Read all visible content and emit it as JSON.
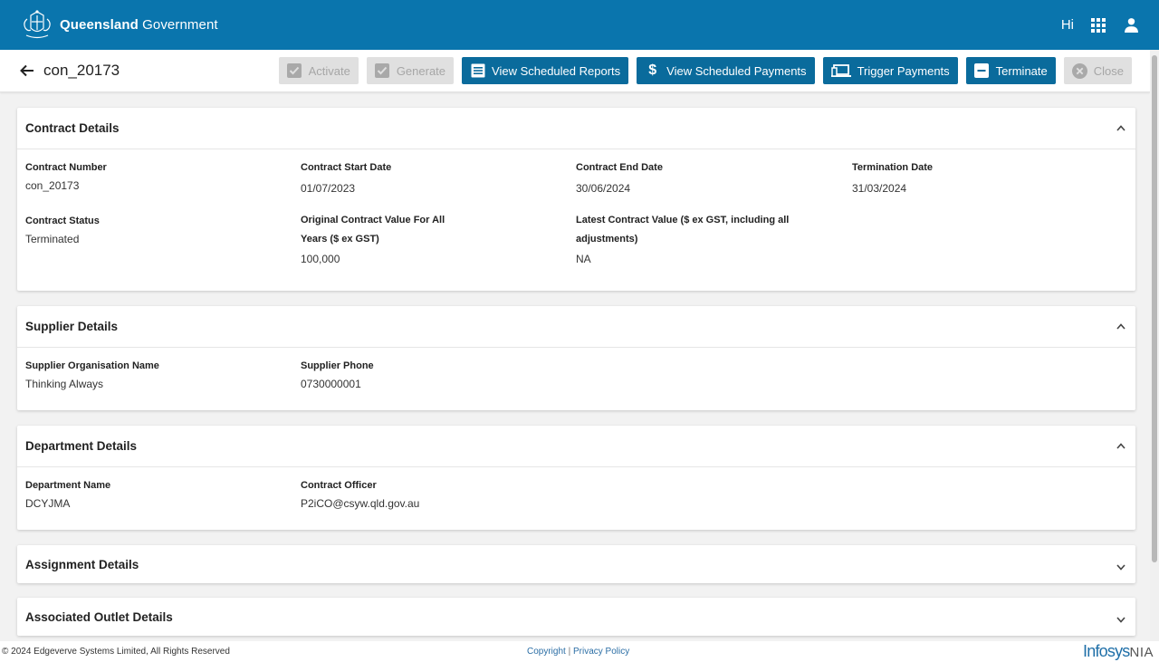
{
  "header": {
    "brand_bold": "Queensland",
    "brand_rest": " Government",
    "greeting": "Hi",
    "icons": [
      "apps-grid-icon",
      "user-icon"
    ]
  },
  "subheader": {
    "title": "con_20173",
    "buttons": [
      {
        "label": "Activate",
        "icon": "check-box-icon",
        "enabled": false
      },
      {
        "label": "Generate",
        "icon": "check-box-icon",
        "enabled": false
      },
      {
        "label": "View Scheduled Reports",
        "icon": "list-icon",
        "enabled": true
      },
      {
        "label": "View Scheduled Payments",
        "icon": "dollar-icon",
        "enabled": true
      },
      {
        "label": "Trigger Payments",
        "icon": "devices-icon",
        "enabled": true
      },
      {
        "label": "Terminate",
        "icon": "minus-box-icon",
        "enabled": true
      },
      {
        "label": "Close",
        "icon": "close-circle-icon",
        "enabled": false
      }
    ]
  },
  "contract": {
    "title": "Contract Details",
    "number_label": "Contract Number",
    "number": "con_20173",
    "start_label": "Contract Start Date",
    "start": "01/07/2023",
    "end_label": "Contract End Date",
    "end": "30/06/2024",
    "term_label": "Termination Date",
    "term": "31/03/2024",
    "status_label": "Contract Status",
    "status": "Terminated",
    "orig_label_1": "Original Contract Value For All",
    "orig_label_2": "Years ($ ex GST)",
    "orig": "100,000",
    "latest_label_1": "Latest Contract Value ($ ex GST, including all",
    "latest_label_2": "adjustments)",
    "latest": "NA"
  },
  "supplier": {
    "title": "Supplier Details",
    "org_label": "Supplier Organisation Name",
    "org": "Thinking Always",
    "phone_label": "Supplier Phone",
    "phone": "0730000001"
  },
  "department": {
    "title": "Department Details",
    "name_label": "Department Name",
    "name": "DCYJMA",
    "officer_label": "Contract Officer",
    "officer": "P2iCO@csyw.qld.gov.au"
  },
  "assignment": {
    "title": "Assignment Details"
  },
  "outlet": {
    "title": "Associated Outlet Details"
  },
  "footer": {
    "copyright": "© 2024 Edgeverve Systems Limited, All Rights Reserved",
    "link_copyright": "Copyright",
    "separator": " | ",
    "link_privacy": "Privacy Policy",
    "logo_main": "Infosys",
    "logo_sub": "NIA"
  },
  "colors": {
    "brand_blue": "#0a75ad",
    "button_blue": "#0a6b9c",
    "disabled_grey": "#e0e0e0"
  }
}
